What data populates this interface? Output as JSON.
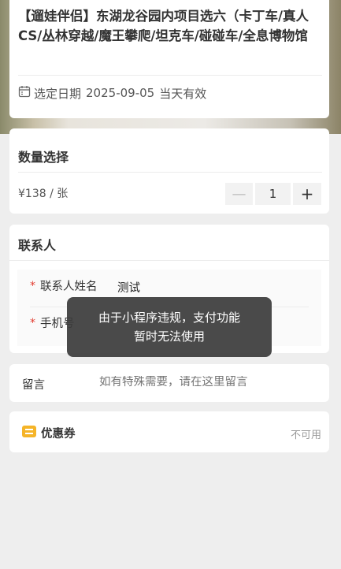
{
  "product": {
    "title": "【遛娃伴侣】东湖龙谷园内项目选六（卡丁车/真人CS/丛林穿越/魔王攀爬/坦克车/碰碰车/全息博物馆",
    "date_label": "选定日期",
    "date_value": "2025-09-05",
    "date_note": "当天有效"
  },
  "quantity": {
    "title": "数量选择",
    "price": "¥138 / 张",
    "minus": "—",
    "count": "1",
    "plus": "+"
  },
  "contact": {
    "title": "联系人",
    "required_mark": "*",
    "name_label": "联系人姓名",
    "name_value": "测试",
    "phone_label": "手机号"
  },
  "note": {
    "label": "留言",
    "placeholder": "如有特殊需要，请在这里留言"
  },
  "coupon": {
    "label": "优惠券",
    "status": "不可用"
  },
  "toast": {
    "line1": "由于小程序违规，支付功能",
    "line2": "暂时无法使用"
  }
}
